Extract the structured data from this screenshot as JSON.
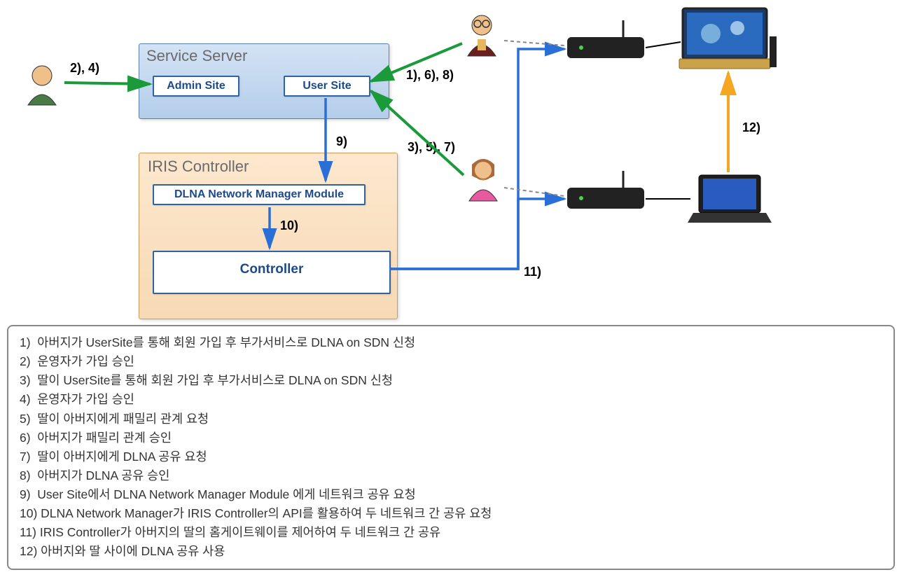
{
  "service_server": {
    "title": "Service Server",
    "admin_site": "Admin Site",
    "user_site": "User Site"
  },
  "iris_controller": {
    "title": "IRIS Controller",
    "dlna_module": "DLNA Network Manager Module",
    "controller": "Controller"
  },
  "edge_labels": {
    "e24": "2), 4)",
    "e168": "1), 6), 8)",
    "e357": "3), 5), 7)",
    "e9": "9)",
    "e10": "10)",
    "e11": "11)",
    "e12": "12)"
  },
  "actors": {
    "operator": "운영자",
    "father": "아버지",
    "daughter": "딸"
  },
  "devices": {
    "router": "router-icon",
    "tv": "tv-icon",
    "laptop": "laptop-icon"
  },
  "legend": [
    "1)  아버지가 UserSite를 통해 회원 가입 후 부가서비스로 DLNA on SDN 신청",
    "2)  운영자가 가입 승인",
    "3)  딸이 UserSite를 통해 회원 가입 후 부가서비스로 DLNA on SDN 신청",
    "4)  운영자가 가입 승인",
    "5)  딸이 아버지에게 패밀리 관계 요청",
    "6)  아버지가 패밀리 관계 승인",
    "7)  딸이 아버지에게 DLNA 공유 요청",
    "8)  아버지가 DLNA 공유 승인",
    "9)  User Site에서 DLNA Network Manager Module 에게 네트워크 공유 요청",
    "10) DLNA Network Manager가 IRIS Controller의 API를 활용하여 두 네트워크 간 공유 요청",
    "11) IRIS Controller가 아버지의 딸의 홈게이트웨이를 제어하여 두 네트워크 간 공유",
    "12) 아버지와 딸 사이에 DLNA 공유 사용"
  ],
  "chart_data": {
    "type": "diagram",
    "nodes": [
      {
        "id": "operator",
        "kind": "actor"
      },
      {
        "id": "father",
        "kind": "actor"
      },
      {
        "id": "daughter",
        "kind": "actor"
      },
      {
        "id": "service_server",
        "kind": "container",
        "children": [
          "admin_site",
          "user_site"
        ]
      },
      {
        "id": "admin_site",
        "kind": "module"
      },
      {
        "id": "user_site",
        "kind": "module"
      },
      {
        "id": "iris_controller",
        "kind": "container",
        "children": [
          "dlna_module",
          "controller"
        ]
      },
      {
        "id": "dlna_module",
        "kind": "module"
      },
      {
        "id": "controller",
        "kind": "module"
      },
      {
        "id": "router1",
        "kind": "device"
      },
      {
        "id": "router2",
        "kind": "device"
      },
      {
        "id": "tv",
        "kind": "device"
      },
      {
        "id": "laptop",
        "kind": "device"
      }
    ],
    "edges": [
      {
        "from": "operator",
        "to": "admin_site",
        "label": "2), 4)",
        "color": "green"
      },
      {
        "from": "father",
        "to": "user_site",
        "label": "1), 6), 8)",
        "color": "green"
      },
      {
        "from": "daughter",
        "to": "user_site",
        "label": "3), 5), 7)",
        "color": "green"
      },
      {
        "from": "user_site",
        "to": "dlna_module",
        "label": "9)",
        "color": "blue"
      },
      {
        "from": "dlna_module",
        "to": "controller",
        "label": "10)",
        "color": "blue"
      },
      {
        "from": "controller",
        "to": "router1",
        "label": "11)",
        "color": "blue"
      },
      {
        "from": "controller",
        "to": "router2",
        "label": "11)",
        "color": "blue"
      },
      {
        "from": "laptop",
        "to": "tv",
        "label": "12)",
        "color": "orange"
      },
      {
        "from": "father",
        "to": "router1",
        "style": "dashed"
      },
      {
        "from": "daughter",
        "to": "router2",
        "style": "dashed"
      },
      {
        "from": "router1",
        "to": "tv",
        "color": "black"
      },
      {
        "from": "router2",
        "to": "laptop",
        "color": "black"
      }
    ]
  }
}
